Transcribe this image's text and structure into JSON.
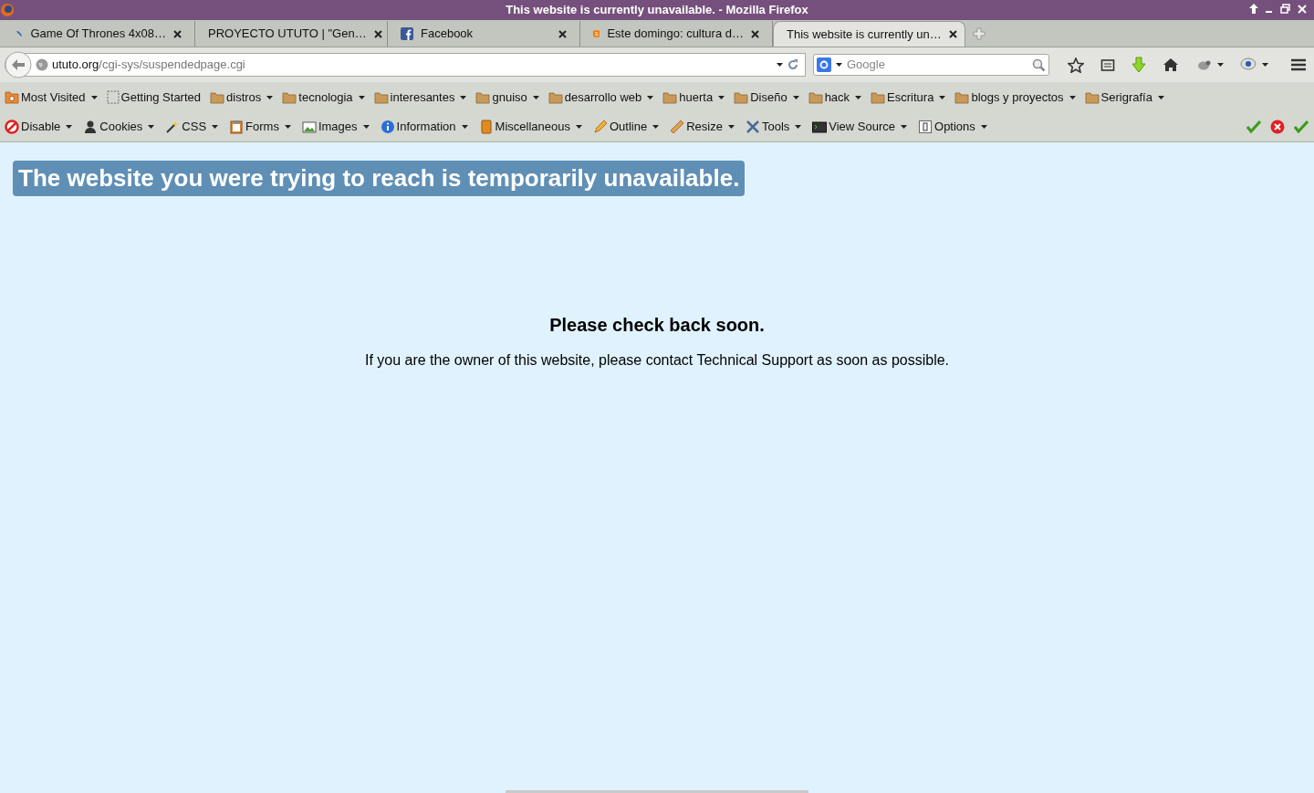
{
  "window": {
    "title": "This website is currently unavailable. - Mozilla Firefox"
  },
  "tabs": [
    {
      "label": "Game Of Thrones 4x08…",
      "kind": "bird",
      "selected": false
    },
    {
      "label": "PROYECTO UTUTO | \"Gen…",
      "kind": "plain",
      "selected": false
    },
    {
      "label": "Facebook",
      "kind": "facebook",
      "selected": false
    },
    {
      "label": "Este domingo: cultura d…",
      "kind": "blogger",
      "selected": false
    },
    {
      "label": "This website is currently un…",
      "kind": "plain",
      "selected": true
    }
  ],
  "address": {
    "host": "ututo.org",
    "path": "/cgi-sys/suspendedpage.cgi"
  },
  "search": {
    "placeholder": "Google"
  },
  "bookmarks": [
    {
      "label": "Most Visited",
      "kind": "smart",
      "menu": true
    },
    {
      "label": "Getting Started",
      "kind": "page",
      "menu": false
    },
    {
      "label": "distros",
      "kind": "folder",
      "menu": true
    },
    {
      "label": "tecnologia",
      "kind": "folder",
      "menu": true
    },
    {
      "label": "interesantes",
      "kind": "folder",
      "menu": true
    },
    {
      "label": "gnuiso",
      "kind": "folder",
      "menu": true
    },
    {
      "label": "desarrollo web",
      "kind": "folder",
      "menu": true
    },
    {
      "label": "huerta",
      "kind": "folder",
      "menu": true
    },
    {
      "label": "Diseño",
      "kind": "folder",
      "menu": true
    },
    {
      "label": "hack",
      "kind": "folder",
      "menu": true
    },
    {
      "label": "Escritura",
      "kind": "folder",
      "menu": true
    },
    {
      "label": "blogs y proyectos",
      "kind": "folder",
      "menu": true
    },
    {
      "label": "Serigrafía",
      "kind": "folder",
      "menu": true
    }
  ],
  "devtools": [
    {
      "label": "Disable",
      "kind": "disable"
    },
    {
      "label": "Cookies",
      "kind": "cookies"
    },
    {
      "label": "CSS",
      "kind": "css"
    },
    {
      "label": "Forms",
      "kind": "forms"
    },
    {
      "label": "Images",
      "kind": "images"
    },
    {
      "label": "Information",
      "kind": "information"
    },
    {
      "label": "Miscellaneous",
      "kind": "misc"
    },
    {
      "label": "Outline",
      "kind": "outline"
    },
    {
      "label": "Resize",
      "kind": "resize"
    },
    {
      "label": "Tools",
      "kind": "tools"
    },
    {
      "label": "View Source",
      "kind": "source"
    },
    {
      "label": "Options",
      "kind": "options"
    }
  ],
  "status_icons": [
    {
      "kind": "ok"
    },
    {
      "kind": "error"
    },
    {
      "kind": "ok"
    }
  ],
  "page": {
    "banner": "The website you were trying to reach is temporarily unavailable.",
    "heading": "Please check back soon.",
    "message": "If you are the owner of this website, please contact Technical Support as soon as possible."
  }
}
